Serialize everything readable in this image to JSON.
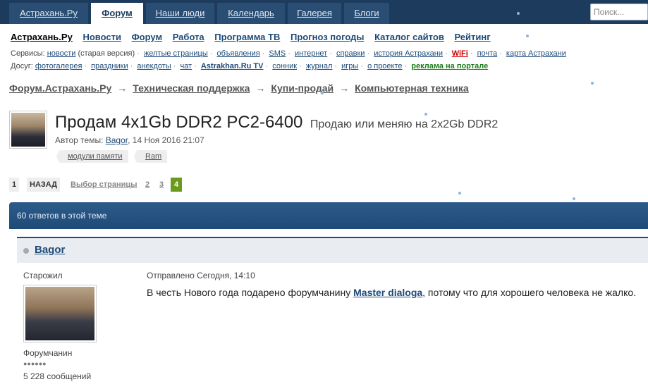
{
  "topnav": {
    "tabs": [
      {
        "label": "Астрахань.Ру"
      },
      {
        "label": "Форум",
        "active": true
      },
      {
        "label": "Наши люди"
      },
      {
        "label": "Календарь"
      },
      {
        "label": "Галерея"
      },
      {
        "label": "Блоги"
      }
    ],
    "search_placeholder": "Поиск..."
  },
  "siteline": {
    "home": "Астрахань.Ру",
    "links": [
      "Новости",
      "Форум",
      "Работа",
      "Программа ТВ",
      "Прогноз погоды",
      "Каталог сайтов",
      "Рейтинг"
    ]
  },
  "services": {
    "label": "Сервисы:",
    "news": "новости",
    "news_note": "(старая версия)",
    "links": [
      "желтые страницы",
      "объявления",
      "SMS",
      "интернет",
      "справки",
      "история Астрахани",
      "WiFi",
      "почта",
      "карта Астрахани"
    ]
  },
  "leisure": {
    "label": "Досуг:",
    "links": [
      "фотогалерея",
      "праздники",
      "анекдоты",
      "чат",
      "Astrakhan.Ru TV",
      "сонник",
      "журнал",
      "игры",
      "о проекте",
      "реклама на портале"
    ]
  },
  "breadcrumb": [
    "Форум.Астрахань.Ру",
    "Техническая поддержка",
    "Купи-продай",
    "Компьютерная техника"
  ],
  "breadcrumb_sep": "→",
  "topic": {
    "title": "Продам 4x1Gb DDR2 PC2-6400",
    "subtitle": "Продаю или меняю на 2x2Gb DDR2",
    "author_label": "Автор темы:",
    "author": "Bagor",
    "date": ", 14 Ноя 2016 21:07",
    "tags": [
      "модули памяти",
      "Ram"
    ]
  },
  "pager": {
    "first": "1",
    "back": "НАЗАД",
    "select": "Выбор страницы",
    "pages": [
      "2",
      "3"
    ],
    "current": "4"
  },
  "replies": "60 ответов в этой теме",
  "post": {
    "author": "Bagor",
    "rank": "Старожил",
    "role": "Форумчанин",
    "pips": "●●●●●●",
    "messages": "5 228 сообщений",
    "posted": "Отправлено Сегодня, 14:10",
    "text_before": "В честь Нового года подарено форумчанину ",
    "text_link": "Master dialoga",
    "text_after": ", потому что для хорошего человека не жалко."
  }
}
